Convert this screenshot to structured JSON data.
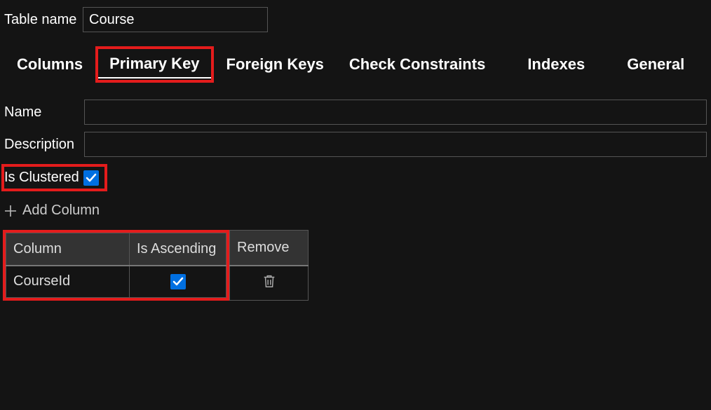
{
  "header": {
    "table_name_label": "Table name",
    "table_name_value": "Course"
  },
  "tabs": {
    "columns": "Columns",
    "primary_key": "Primary Key",
    "foreign_keys": "Foreign Keys",
    "check_constraints": "Check Constraints",
    "indexes": "Indexes",
    "general": "General",
    "active": "primary_key"
  },
  "pk": {
    "name_label": "Name",
    "name_value": "",
    "description_label": "Description",
    "description_value": "",
    "is_clustered_label": "Is Clustered",
    "is_clustered_checked": true,
    "add_column_label": "Add Column",
    "table": {
      "headers": {
        "column": "Column",
        "is_ascending": "Is Ascending",
        "remove": "Remove"
      },
      "rows": [
        {
          "column": "CourseId",
          "is_ascending": true
        }
      ]
    }
  },
  "icons": {
    "plus": "plus-icon",
    "trash": "trash-icon",
    "check": "check-icon"
  }
}
